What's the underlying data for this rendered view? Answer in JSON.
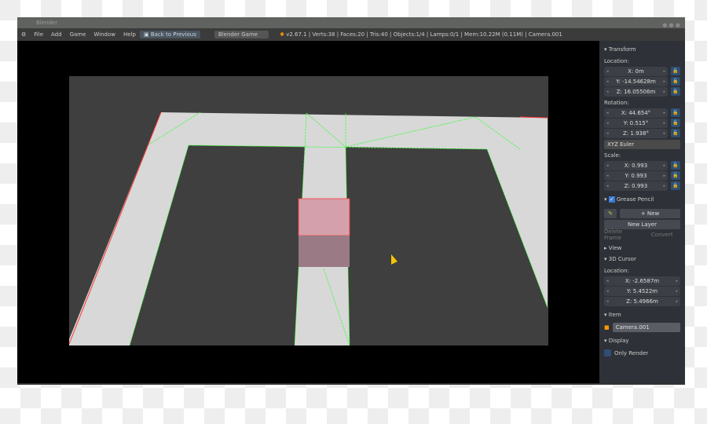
{
  "window": {
    "title": "Blender"
  },
  "menu": {
    "items": [
      "File",
      "Add",
      "Game",
      "Window",
      "Help"
    ],
    "back_button": "Back to Previous",
    "engine": "Blender Game",
    "stats": "v2.67.1 | Verts:38 | Faces:20 | Tris:40 | Objects:1/4 | Lamps:0/1 | Mem:10.22M (0.11M) | Camera.001"
  },
  "panel": {
    "transform": {
      "title": "Transform",
      "location_label": "Location:",
      "location": [
        "X: 0m",
        "Y: -14.54628m",
        "Z: 16.05506m"
      ],
      "rotation_label": "Rotation:",
      "rotation": [
        "X: 44.654°",
        "Y: 0.515°",
        "Z: 1.938°"
      ],
      "rotation_mode": "XYZ Euler",
      "scale_label": "Scale:",
      "scale": [
        "X: 0.993",
        "Y: 0.993",
        "Z: 0.993"
      ]
    },
    "grease_pencil": {
      "title": "Grease Pencil",
      "checked": true,
      "new": "New",
      "new_layer": "New Layer",
      "delete_frame": "Delete Frame",
      "convert": "Convert"
    },
    "view": {
      "title": "View"
    },
    "cursor": {
      "title": "3D Cursor",
      "location_label": "Location:",
      "location": [
        "X: -2.6587m",
        "Y: 5.4522m",
        "Z: 5.4966m"
      ]
    },
    "item": {
      "title": "Item",
      "name": "Camera.001"
    },
    "display": {
      "title": "Display",
      "only_render": "Only Render",
      "only_render_checked": false
    }
  },
  "colors": {
    "accent": "#2e4f73",
    "floor": "#d8d8d8",
    "edge_green": "#33ff33",
    "edge_red": "#ff3333",
    "cube": "#d4a0ac"
  }
}
